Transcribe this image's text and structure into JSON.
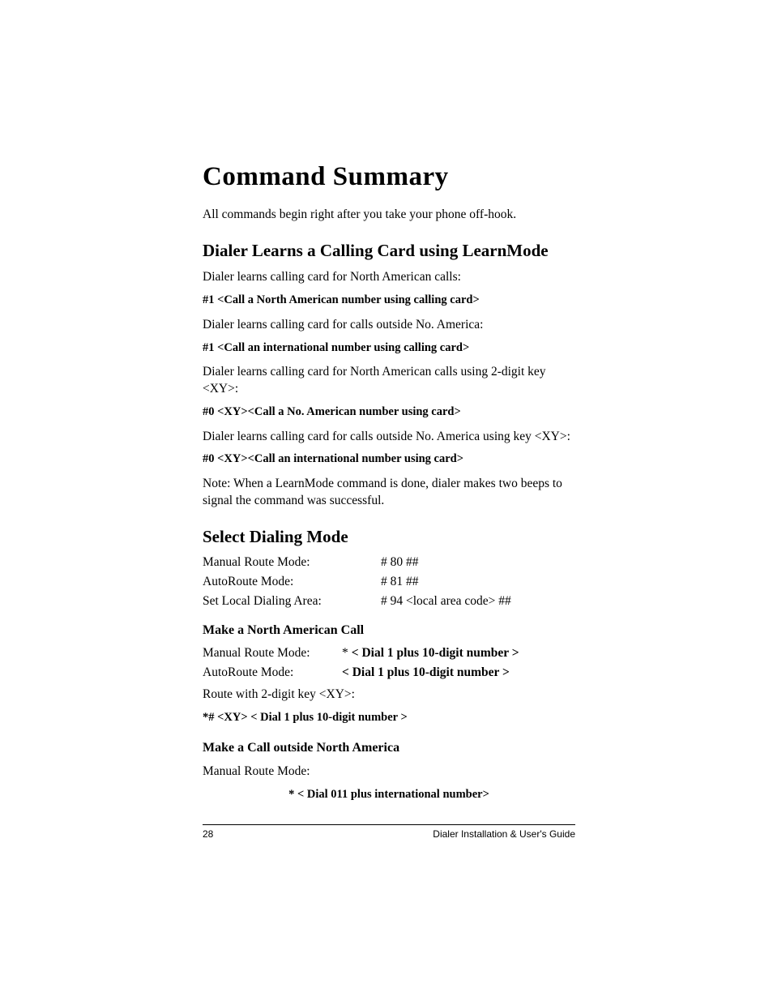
{
  "title": "Command Summary",
  "intro": "All commands begin right after you take your phone off-hook.",
  "section1": {
    "heading": "Dialer Learns a Calling Card using LearnMode",
    "p1": "Dialer learns calling card for North American calls:",
    "c1": "#1 <Call a North American number using calling card>",
    "p2": "Dialer learns calling card for calls outside No. America:",
    "c2": "#1 <Call an international number using calling card>",
    "p3": "Dialer learns calling card for North American calls using 2-digit key <XY>:",
    "c3": "#0 <XY><Call a No. American number using card>",
    "p4": "Dialer learns calling card for calls outside No. America using key <XY>:",
    "c4": "#0 <XY><Call an international number using card>",
    "note": "Note: When a LearnMode command is done, dialer makes two beeps to signal the command was successful."
  },
  "section2": {
    "heading": "Select Dialing Mode",
    "rows": [
      {
        "label": "Manual Route Mode:",
        "value": "# 80 ##"
      },
      {
        "label": "AutoRoute Mode:",
        "value": "# 81 ##"
      },
      {
        "label": "Set Local Dialing Area:",
        "value": "# 94 <local area code> ##"
      }
    ]
  },
  "section3": {
    "heading": "Make a North American Call",
    "row1": {
      "label": "Manual Route Mode:",
      "star": "*",
      "value": "< Dial 1 plus 10-digit number >"
    },
    "row2": {
      "label": "AutoRoute Mode:",
      "value": "< Dial 1 plus 10-digit number >"
    },
    "p1": "Route with 2-digit key <XY>:",
    "c1": " *# <XY> < Dial 1 plus 10-digit number >"
  },
  "section4": {
    "heading": "Make a Call outside North America",
    "p1": "Manual Route Mode:",
    "c1": "* < Dial 011 plus international number>"
  },
  "footer": {
    "page": "28",
    "title": "Dialer Installation & User's Guide"
  }
}
